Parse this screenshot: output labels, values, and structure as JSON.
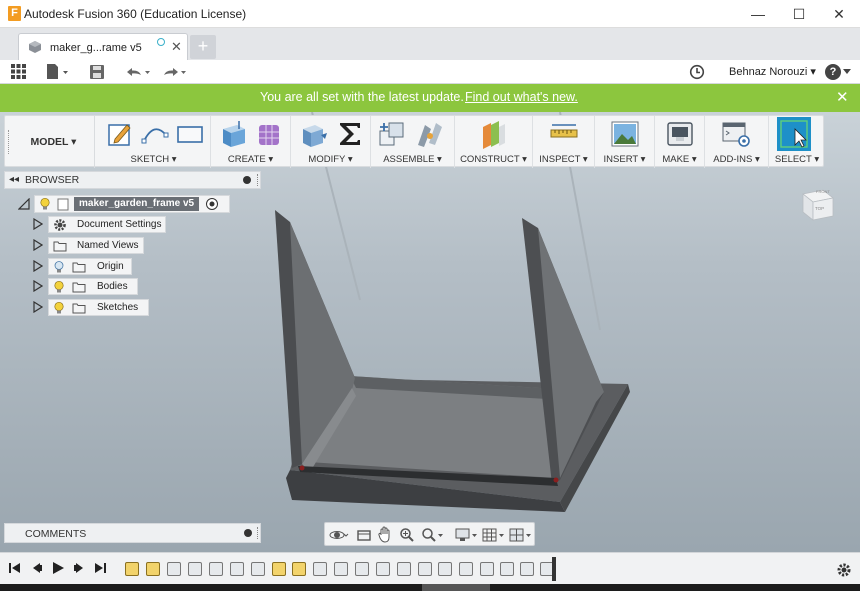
{
  "window": {
    "app_icon_letter": "F",
    "title": "Autodesk Fusion 360 (Education License)",
    "minimize": "—",
    "maximize": "☐",
    "close": "✕"
  },
  "tabs": {
    "active_label": "maker_g...rame v5",
    "close": "✕",
    "new_tab": "+"
  },
  "quick_access": {
    "user": "Behnaz Norouzi ▾",
    "help": "?"
  },
  "banner": {
    "text": "You are all set with the latest update.",
    "link": "Find out what's new.",
    "close": "✕",
    "color": "#8cc63e"
  },
  "toolbar": {
    "workspace": "MODEL ▾",
    "groups": [
      {
        "label": "SKETCH ▾"
      },
      {
        "label": "CREATE ▾"
      },
      {
        "label": "MODIFY ▾"
      },
      {
        "label": "ASSEMBLE ▾"
      },
      {
        "label": "CONSTRUCT ▾"
      },
      {
        "label": "INSPECT ▾"
      },
      {
        "label": "INSERT ▾"
      },
      {
        "label": "MAKE ▾"
      },
      {
        "label": "ADD-INS ▾"
      },
      {
        "label": "SELECT ▾"
      }
    ]
  },
  "browser": {
    "title": "BROWSER",
    "root": "maker_garden_frame v5",
    "items": [
      {
        "label": "Document Settings"
      },
      {
        "label": "Named Views"
      },
      {
        "label": "Origin"
      },
      {
        "label": "Bodies"
      },
      {
        "label": "Sketches"
      }
    ]
  },
  "comments": {
    "title": "COMMENTS"
  },
  "viewcube": {
    "front": "FRONT",
    "top": "TOP"
  }
}
